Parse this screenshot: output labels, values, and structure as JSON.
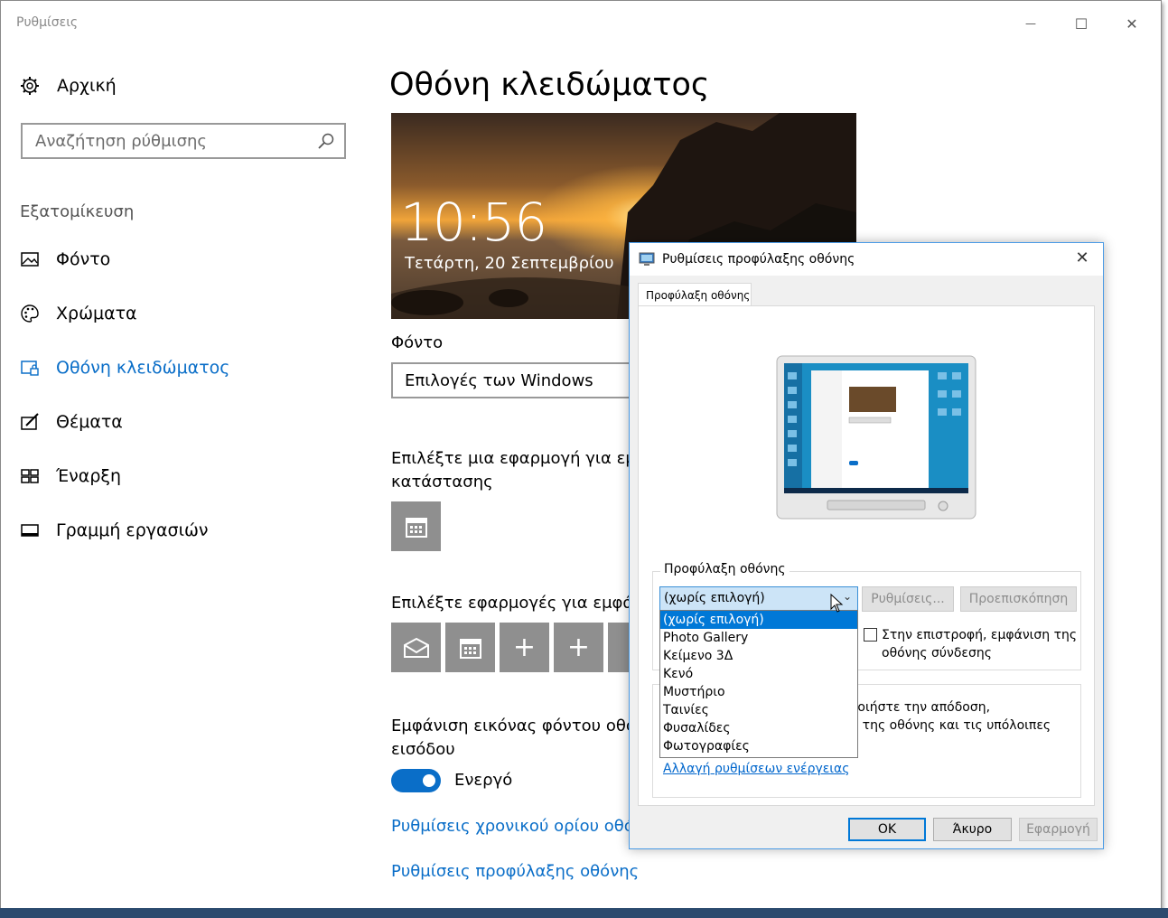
{
  "window": {
    "title": "Ρυθμίσεις",
    "controls": {
      "minimize": "—",
      "maximize": "☐",
      "close": "✕"
    }
  },
  "sidebar": {
    "home_label": "Αρχική",
    "search_placeholder": "Αναζήτηση ρύθμισης",
    "section": "Εξατομίκευση",
    "items": [
      {
        "label": "Φόντο",
        "icon": "picture-icon"
      },
      {
        "label": "Χρώματα",
        "icon": "palette-icon"
      },
      {
        "label": "Οθόνη κλειδώματος",
        "icon": "lock-screen-icon",
        "active": true
      },
      {
        "label": "Θέματα",
        "icon": "brush-icon"
      },
      {
        "label": "Έναρξη",
        "icon": "start-icon"
      },
      {
        "label": "Γραμμή εργασιών",
        "icon": "taskbar-icon"
      }
    ]
  },
  "main": {
    "title": "Οθόνη κλειδώματος",
    "preview": {
      "time": "10:56",
      "date": "Τετάρτη, 20 Σεπτεμβρίου"
    },
    "background_label": "Φόντο",
    "background_value": "Επιλογές των Windows",
    "detailed_status_line1": "Επιλέξτε μια εφαρμογή για εμφ",
    "detailed_status_line2": "κατάστασης",
    "quick_status_line": "Επιλέξτε εφαρμογές για εμφάνι",
    "signin_bg_line1": "Εμφάνιση εικόνας φόντου οθόν",
    "signin_bg_line2": "εισόδου",
    "toggle_label": "Ενεργό",
    "toggle_on": true,
    "link_timeout": "Ρυθμίσεις χρονικού ορίου οθόν",
    "link_screensaver": "Ρυθμίσεις προφύλαξης οθόνης",
    "tile_plus": "+"
  },
  "dialog": {
    "title": "Ρυθμίσεις προφύλαξης οθόνης",
    "close": "✕",
    "tab": "Προφύλαξη οθόνης",
    "group_label": "Προφύλαξη οθόνης",
    "selected": "(χωρίς επιλογή)",
    "settings_button": "Ρυθμίσεις...",
    "preview_button": "Προεπισκόπηση",
    "resume_line1": "Στην επιστροφή, εμφάνιση της",
    "resume_line2": "οθόνης σύνδεσης",
    "power_line1": "ποιήστε την απόδοση,",
    "power_line2": "α της οθόνης και τις υπόλοιπες",
    "power_link": "Αλλαγή ρυθμίσεων ενέργειας",
    "options": [
      "(χωρίς επιλογή)",
      "Photo Gallery",
      "Κείμενο 3Δ",
      "Κενό",
      "Μυστήριο",
      "Ταινίες",
      "Φυσαλίδες",
      "Φωτογραφίες"
    ],
    "ok": "OK",
    "cancel": "Άκυρο",
    "apply": "Εφαρμογή"
  }
}
